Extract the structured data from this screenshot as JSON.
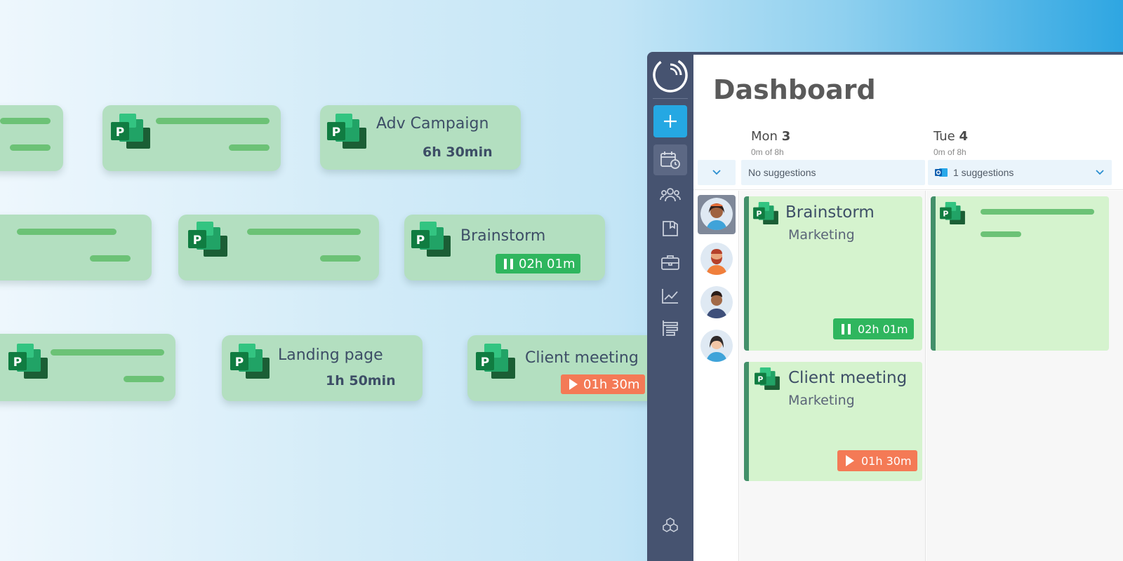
{
  "floating_cards": [
    {
      "title": "Adv Campaign",
      "duration": "6h 30min"
    },
    {
      "title": "Brainstorm",
      "timer": "02h 01m",
      "timer_state": "running",
      "timer_icon": "pause-icon",
      "color": "#2fb65e"
    },
    {
      "title": "Landing page",
      "duration": "1h 50min"
    },
    {
      "title": "Client meeting",
      "timer": "01h 30m",
      "timer_state": "paused",
      "timer_icon": "play-icon",
      "color": "#f47a56"
    }
  ],
  "app": {
    "page_title": "Dashboard",
    "sidebar": {
      "add_icon": "plus-icon",
      "items": [
        "calendar-clock-icon",
        "team-icon",
        "folder-icon",
        "briefcase-icon",
        "chart-icon",
        "tasks-icon"
      ],
      "bottom_icon": "cubes-icon"
    },
    "days": [
      {
        "label": "Mon",
        "num": "3",
        "logged": "0m",
        "of": "of 8h",
        "suggestions": "No suggestions"
      },
      {
        "label": "Tue",
        "num": "4",
        "logged": "0m",
        "of": "of 8h",
        "suggestions": "1 suggestions",
        "suggestions_icon": "outlook-icon"
      }
    ],
    "events": [
      {
        "title": "Brainstorm",
        "subtitle": "Marketing",
        "timer": "02h 01m",
        "timer_icon": "pause-icon"
      },
      {
        "title": "Client meeting",
        "subtitle": "Marketing",
        "timer": "01h 30m",
        "timer_icon": "play-icon"
      }
    ]
  },
  "colors": {
    "card": "#b3dfc0",
    "accent": "#25a8e3",
    "sidebar": "#465370",
    "event": "#d5f3ce"
  }
}
